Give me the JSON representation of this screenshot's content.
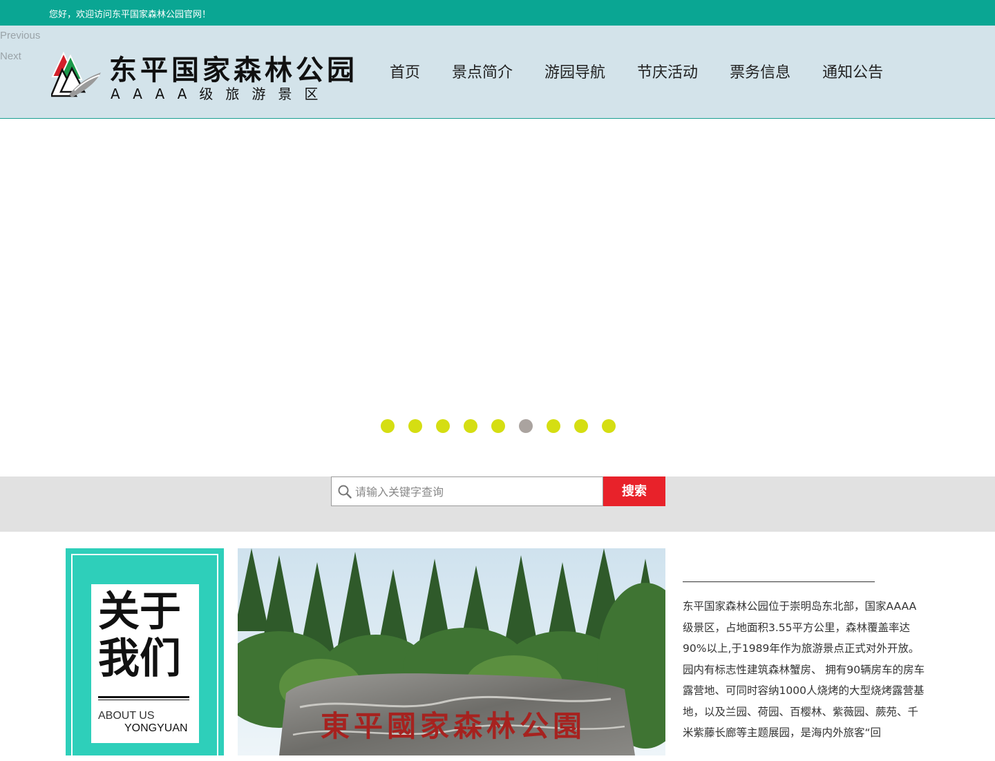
{
  "topbar": {
    "welcome": "您好，欢迎访问东平国家森林公园官网！"
  },
  "slider_controls": {
    "previous": "Previous",
    "next": "Next"
  },
  "logo": {
    "name": "东平国家森林公园",
    "level": "AAAA级旅游景区"
  },
  "nav": {
    "items": [
      {
        "label": "首页"
      },
      {
        "label": "景点简介"
      },
      {
        "label": "游园导航"
      },
      {
        "label": "节庆活动"
      },
      {
        "label": "票务信息"
      },
      {
        "label": "通知公告"
      }
    ]
  },
  "banner": {
    "slide_count": 9,
    "active_index": 5
  },
  "search": {
    "placeholder": "请输入关键字查询",
    "button": "搜索"
  },
  "about": {
    "title_line1": "关于",
    "title_line2": "我们",
    "en_line1": "ABOUT US",
    "en_line2": "YONGYUAN",
    "photo_inscription": "東平國家森林公園",
    "intro": "东平国家森林公园位于崇明岛东北部，国家AAAA级景区，占地面积3.55平方公里，森林覆盖率达90%以上,于1989年作为旅游景点正式对外开放。园内有标志性建筑森林蟹房、 拥有90辆房车的房车露营地、可同时容纳1000人烧烤的大型烧烤露营基地，以及兰园、荷园、百樱林、紫薇园、蕨苑、千米紫藤长廊等主题展园，是海内外旅客“回"
  },
  "colors": {
    "topbar": "#0aa693",
    "header": "#d3e3ea",
    "dot": "#d5de12",
    "dot_active": "#aaa39f",
    "search_button": "#e8222a",
    "about_card": "#2ecfba"
  }
}
